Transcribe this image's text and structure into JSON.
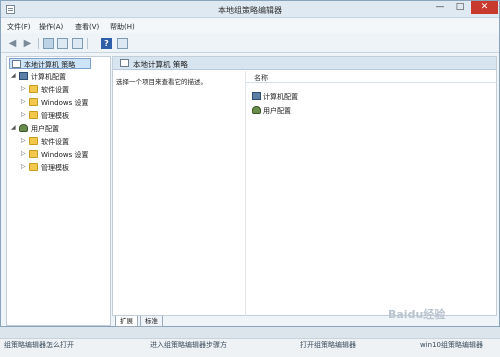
{
  "window": {
    "title": "本地组策略编辑器",
    "controls": {
      "minimize": "—",
      "maximize": "□",
      "close": "✕"
    }
  },
  "menu": [
    "文件(F)",
    "操作(A)",
    "查看(V)",
    "帮助(H)"
  ],
  "toolbar_icons": [
    "back-arrow-icon",
    "forward-arrow-icon",
    "show-hide-tree-icon",
    "properties-icon",
    "export-list-icon",
    "help-icon",
    "filter-icon"
  ],
  "tree": {
    "root": "本地计算机 策略",
    "computer_config": "计算机配置",
    "user_config": "用户配置",
    "computer_children": [
      "软件设置",
      "Windows 设置",
      "管理模板"
    ],
    "user_children": [
      "软件设置",
      "Windows 设置",
      "管理模板"
    ]
  },
  "main": {
    "header_title": "本地计算机 策略",
    "description": "选择一个项目来查看它的描述。",
    "column_name": "名称",
    "items": [
      "计算机配置",
      "用户配置"
    ]
  },
  "tabs": [
    "扩展",
    "标准"
  ],
  "status_under": [
    "组策略编辑器怎么打开",
    "进入组策略编辑器步骤方",
    "打开组策略编辑器",
    "win10组策略编辑器"
  ],
  "watermark": "Baidu经验",
  "colors": {
    "close_button": "#c93a2e",
    "selection": "#cde4f7",
    "folder": "#f2c94c"
  }
}
